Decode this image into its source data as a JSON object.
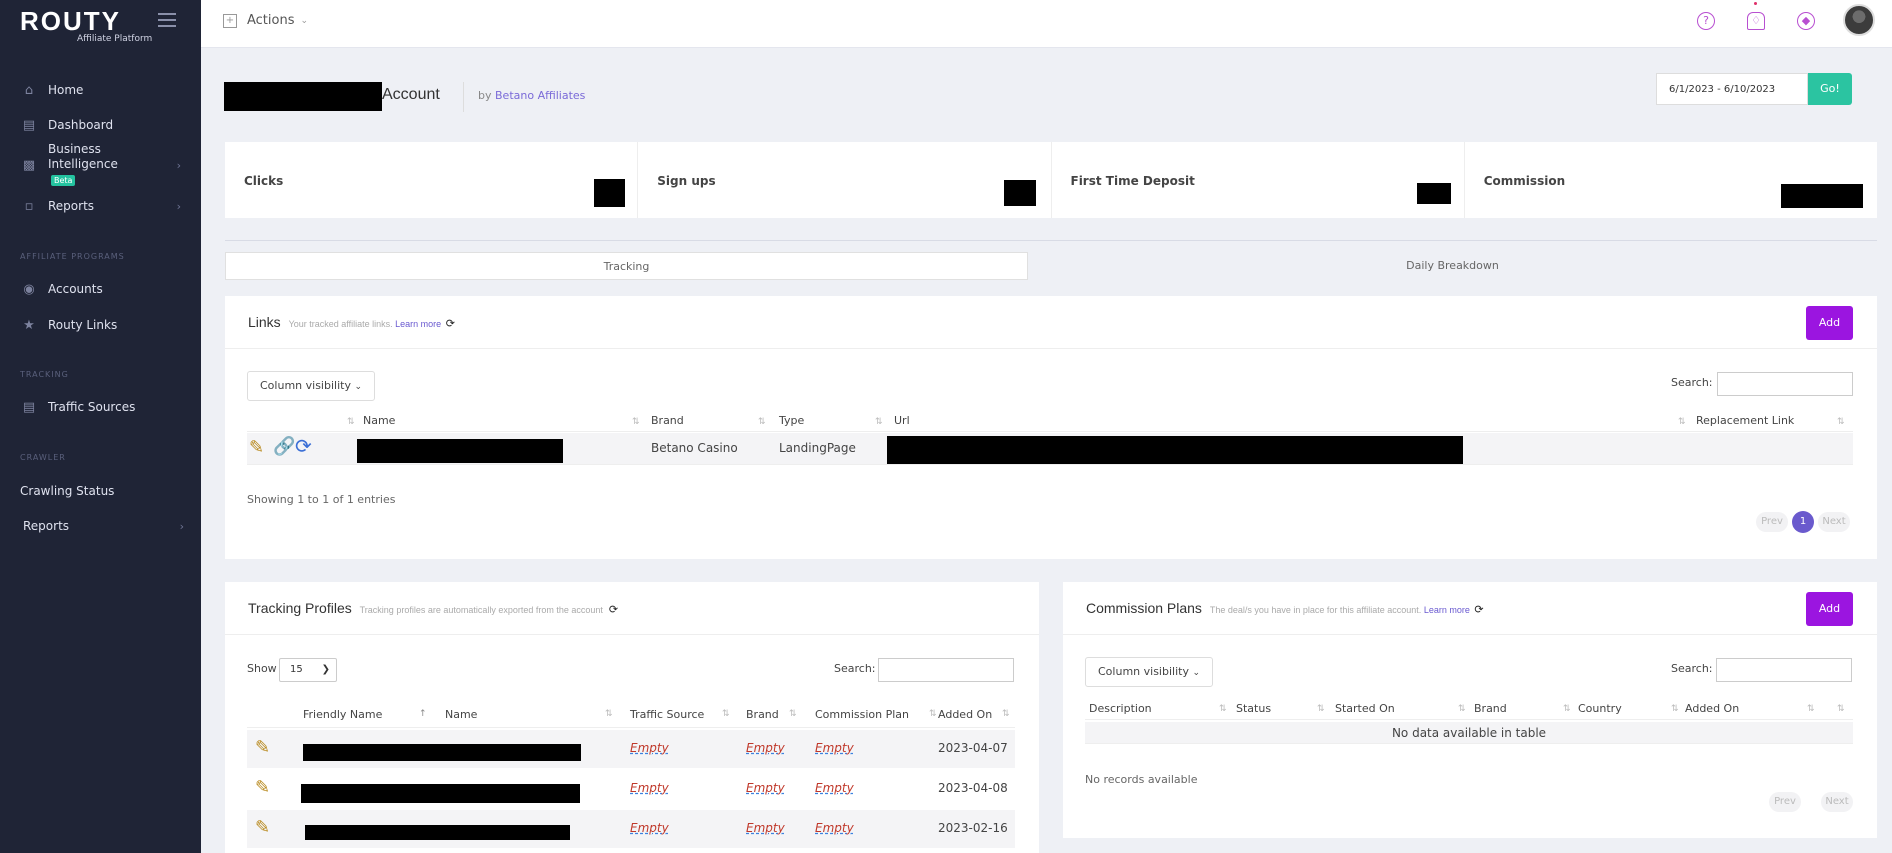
{
  "sidebar": {
    "logo_text": "ROUTY",
    "logo_sub": "Affiliate Platform",
    "items": [
      {
        "label": "Home",
        "icon": "home-icon"
      },
      {
        "label": "Dashboard",
        "icon": "dashboard-icon"
      },
      {
        "label": "Business Intelligence",
        "icon": "chart-icon",
        "badge": "Beta"
      },
      {
        "label": "Reports",
        "icon": "bar-chart-icon"
      }
    ],
    "sections": [
      {
        "label": "Affiliate Programs",
        "items": [
          {
            "label": "Accounts",
            "icon": "user-circle-icon"
          },
          {
            "label": "Routy Links",
            "icon": "star-icon"
          }
        ]
      },
      {
        "label": "Tracking",
        "items": [
          {
            "label": "Traffic Sources",
            "icon": "traffic-icon"
          }
        ]
      },
      {
        "label": "Crawler",
        "items": [
          {
            "label": "Crawling Status"
          },
          {
            "label": "Reports"
          }
        ]
      }
    ]
  },
  "topbar": {
    "actions_label": "Actions"
  },
  "header": {
    "title_suffix": "Account",
    "by_prefix": "by",
    "by_link": "Betano Affiliates",
    "date_range": "6/1/2023 - 6/10/2023",
    "go_label": "Go!"
  },
  "stats": [
    {
      "label": "Clicks"
    },
    {
      "label": "Sign ups"
    },
    {
      "label": "First Time Deposit"
    },
    {
      "label": "Commission"
    }
  ],
  "tabs": [
    {
      "label": "Tracking"
    },
    {
      "label": "Daily Breakdown"
    }
  ],
  "links": {
    "title": "Links",
    "subtitle": "Your tracked affiliate links.",
    "learn_more": "Learn more",
    "add_label": "Add",
    "column_visibility": "Column visibility",
    "search_label": "Search:",
    "columns": [
      "Name",
      "Brand",
      "Type",
      "Url",
      "Replacement Link"
    ],
    "rows": [
      {
        "brand": "Betano Casino",
        "type": "LandingPage"
      }
    ],
    "info": "Showing 1 to 1 of 1 entries",
    "prev": "Prev",
    "page": "1",
    "next": "Next"
  },
  "tracking_profiles": {
    "title": "Tracking Profiles",
    "subtitle": "Tracking profiles are automatically exported from the account",
    "show_label": "Show",
    "show_value": "15",
    "search_label": "Search:",
    "columns": [
      "Friendly Name",
      "Name",
      "Traffic Source",
      "Brand",
      "Commission Plan",
      "Added On"
    ],
    "rows": [
      {
        "traffic_source": "Empty",
        "brand": "Empty",
        "commission_plan": "Empty",
        "added_on": "2023-04-07"
      },
      {
        "traffic_source": "Empty",
        "brand": "Empty",
        "commission_plan": "Empty",
        "added_on": "2023-04-08"
      },
      {
        "traffic_source": "Empty",
        "brand": "Empty",
        "commission_plan": "Empty",
        "added_on": "2023-02-16"
      }
    ]
  },
  "commission_plans": {
    "title": "Commission Plans",
    "subtitle": "The deal/s you have in place for this affiliate account.",
    "learn_more": "Learn more",
    "add_label": "Add",
    "column_visibility": "Column visibility",
    "search_label": "Search:",
    "columns": [
      "Description",
      "Status",
      "Started On",
      "Brand",
      "Country",
      "Added On"
    ],
    "no_data": "No data available in table",
    "no_records": "No records available",
    "prev": "Prev",
    "next": "Next"
  },
  "colors": {
    "sidebar_bg": "#1f2436",
    "accent_purple": "#9b15e0",
    "go_green": "#2bc4a1",
    "page_bubble": "#6a5acd"
  }
}
